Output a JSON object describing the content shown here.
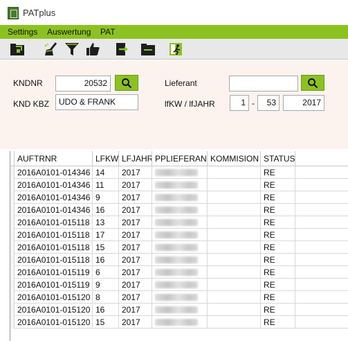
{
  "window": {
    "title": "PATplus"
  },
  "menu": {
    "items": [
      "Settings",
      "Auswertung",
      "PAT"
    ]
  },
  "toolbar": {
    "buttons": [
      "folder-icon",
      "broom-icon",
      "filter-icon",
      "thumbs-up-icon",
      "export-icon",
      "folder-open-icon",
      "exit-icon"
    ]
  },
  "form": {
    "kndnr_label": "KNDNR",
    "kndnr_value": "20532",
    "kndkbz_label": "KND KBZ",
    "kndkbz_value": "UDO & FRANK",
    "lieferant_label": "Lieferant",
    "lieferant_value": "",
    "lfkw_label": "lfKW / lfJAHR",
    "lfkw_from": "1",
    "lfkw_sep": "-",
    "lfkw_to": "53",
    "lfjahr": "2017"
  },
  "table": {
    "columns": [
      "AUFTRNR",
      "LFKW",
      "LFJAHR",
      "PPLIEFERANT",
      "KOMMISION",
      "STATUS"
    ],
    "rows": [
      [
        "2016A0101-014346",
        "14",
        "2017",
        "",
        "",
        "RE"
      ],
      [
        "2016A0101-014346",
        "11",
        "2017",
        "",
        "",
        "RE"
      ],
      [
        "2016A0101-014346",
        "9",
        "2017",
        "",
        "",
        "RE"
      ],
      [
        "2016A0101-014346",
        "16",
        "2017",
        "",
        "",
        "RE"
      ],
      [
        "2016A0101-015118",
        "13",
        "2017",
        "",
        "",
        "RE"
      ],
      [
        "2016A0101-015118",
        "17",
        "2017",
        "",
        "",
        "RE"
      ],
      [
        "2016A0101-015118",
        "15",
        "2017",
        "",
        "",
        "RE"
      ],
      [
        "2016A0101-015118",
        "16",
        "2017",
        "",
        "",
        "RE"
      ],
      [
        "2016A0101-015119",
        "6",
        "2017",
        "",
        "",
        "RE"
      ],
      [
        "2016A0101-015119",
        "9",
        "2017",
        "",
        "",
        "RE"
      ],
      [
        "2016A0101-015120",
        "8",
        "2017",
        "",
        "",
        "RE"
      ],
      [
        "2016A0101-015120",
        "16",
        "2017",
        "",
        "",
        "RE"
      ],
      [
        "2016A0101-015120",
        "15",
        "2017",
        "",
        "",
        "RE"
      ]
    ]
  }
}
